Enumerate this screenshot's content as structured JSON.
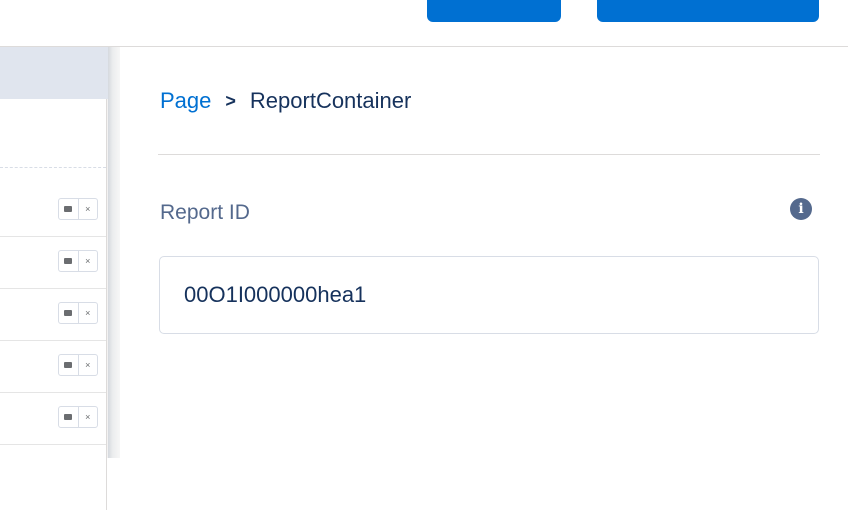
{
  "breadcrumb": {
    "parent": "Page",
    "separator": ">",
    "current": "ReportContainer"
  },
  "field": {
    "label": "Report ID",
    "value": "00O1I000000hea1",
    "info_icon": "info-icon"
  },
  "rows": {
    "close_glyph": "×"
  },
  "colors": {
    "brand_blue": "#0070d2",
    "text_dark": "#16325c",
    "label_gray": "#54698d",
    "border": "#d8dde6"
  }
}
